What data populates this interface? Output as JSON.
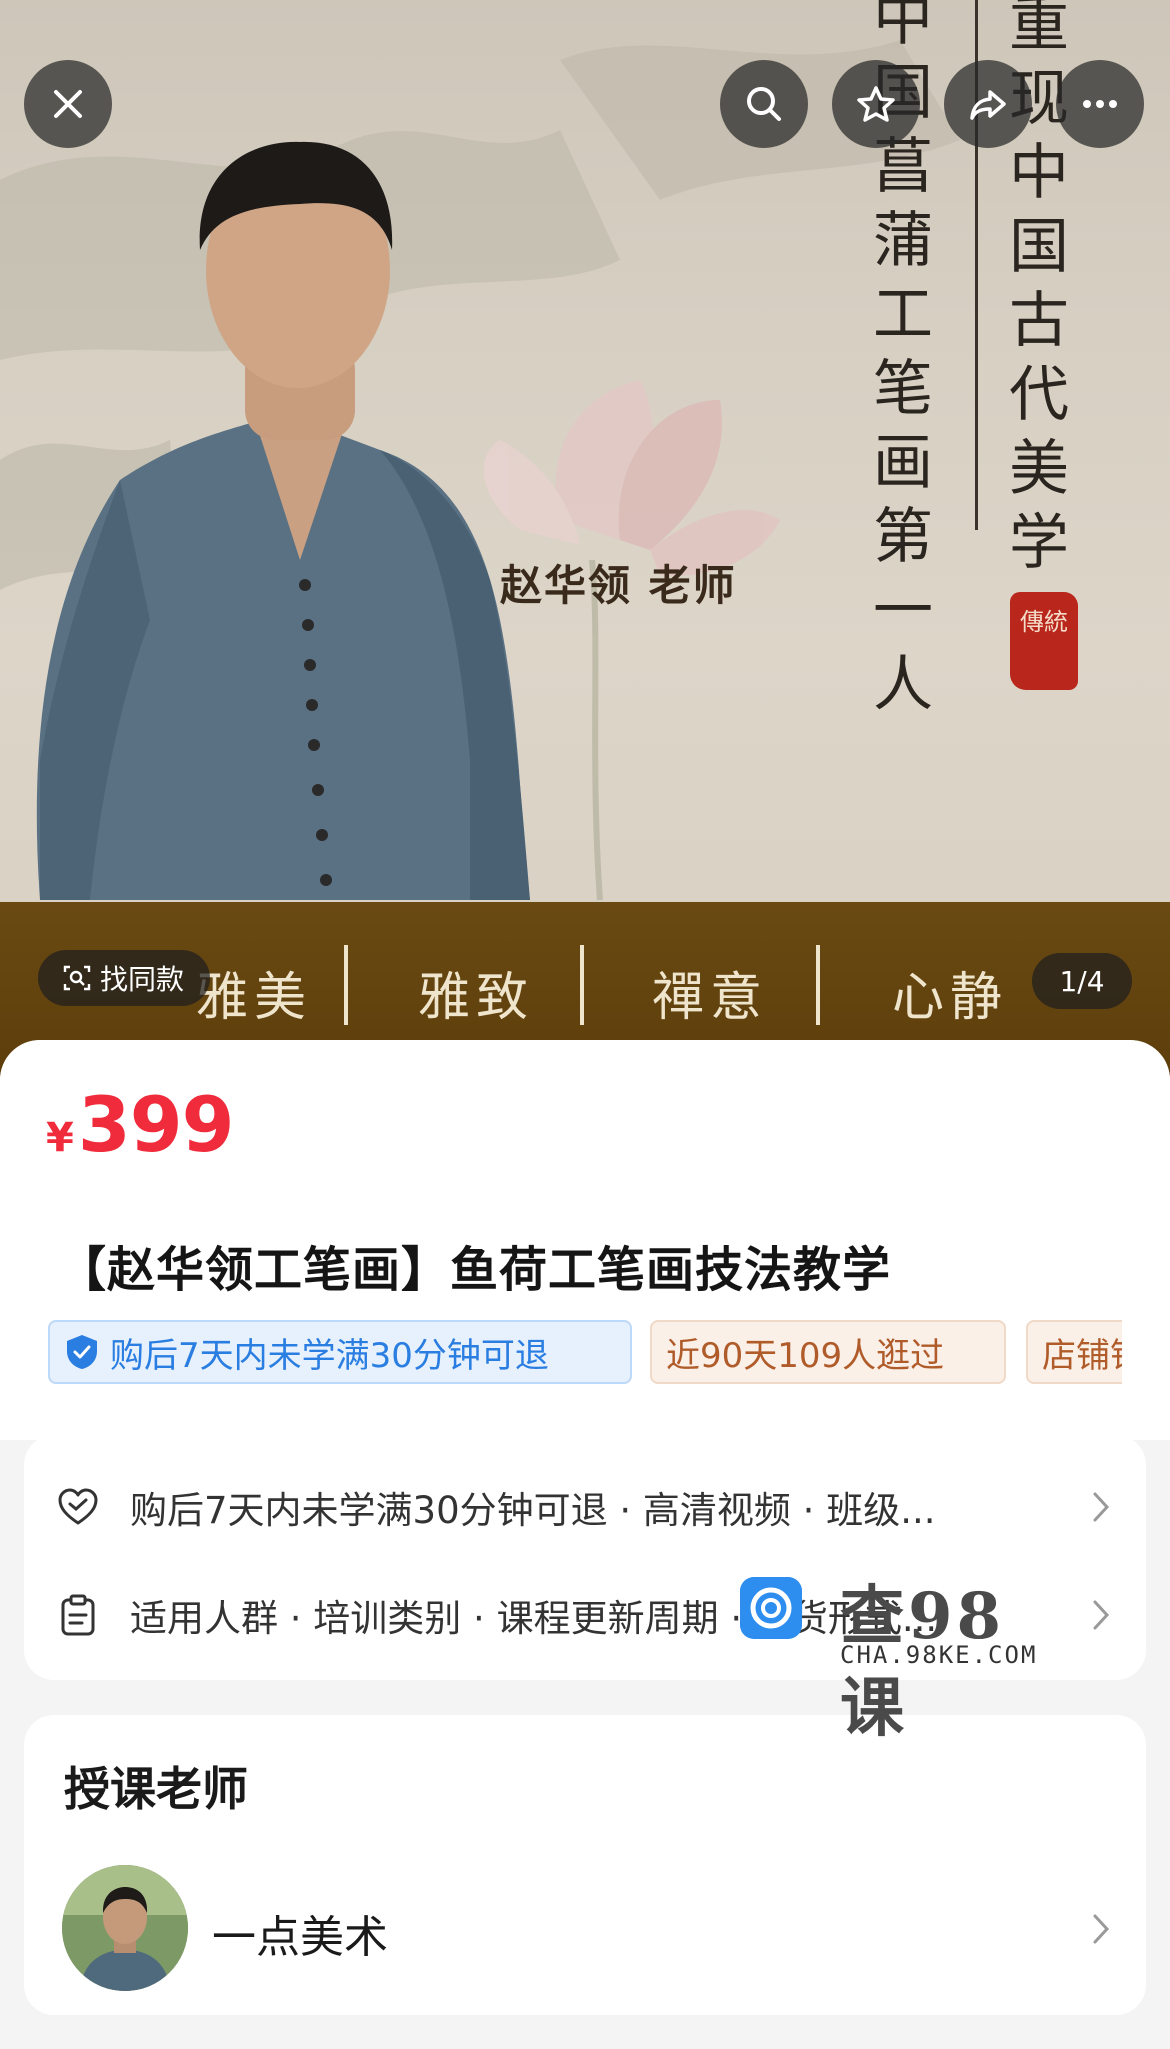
{
  "hero": {
    "vertical_left": "中国菖蒲工笔画第一人",
    "vertical_right": "重现中国古代美学",
    "seal_text": "傳統",
    "teacher_caption": "赵华领 老师",
    "banner_words": [
      "雅美",
      "雅致",
      "禪意",
      "心静"
    ],
    "find_same_label": "找同款",
    "pager": "1/4"
  },
  "toolbar": {
    "close": "close-icon",
    "search": "search-icon",
    "favorite": "star-icon",
    "share": "share-icon",
    "more": "more-icon"
  },
  "product": {
    "currency": "¥",
    "price": "399",
    "title": "【赵华领工笔画】鱼荷工笔画技法教学",
    "tags": {
      "refund": "购后7天内未学满30分钟可退",
      "visits": "近90天109人逛过",
      "shop": "店铺销"
    }
  },
  "services": {
    "row1": "购后7天内未学满30分钟可退 · 高清视频 · 班级...",
    "row2": "适用人群 · 培训类别 · 课程更新周期 · 发货形式..."
  },
  "teacher": {
    "section_title": "授课老师",
    "name": "一点美术"
  },
  "watermark": {
    "text": "查98课",
    "url": "CHA.98KE.COM"
  },
  "colors": {
    "price": "#f02b3b",
    "refund_tag": "#2a7de1",
    "visit_tag": "#b05b2a",
    "banner": "#5d3e0b"
  }
}
